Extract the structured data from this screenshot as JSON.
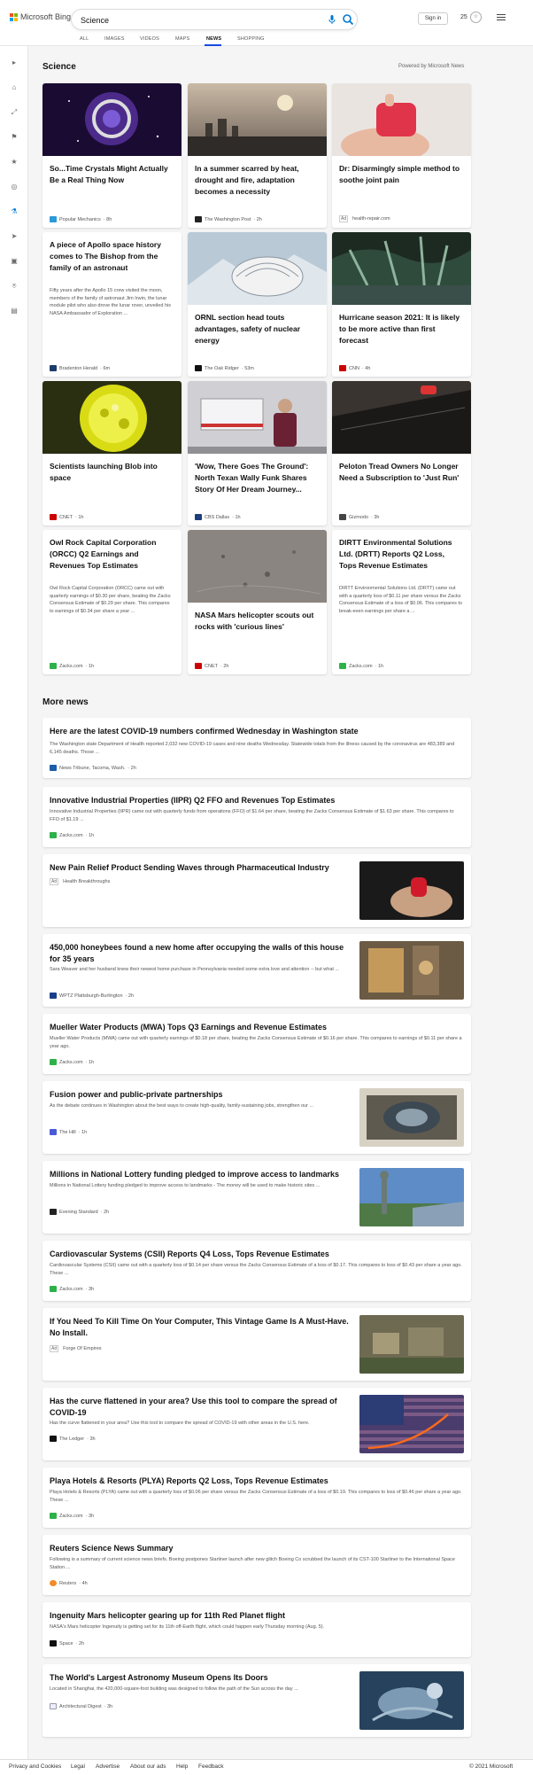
{
  "header": {
    "logo_text": "Microsoft Bing",
    "search_value": "Science",
    "sign_in": "Sign in",
    "rewards_count": "25"
  },
  "nav": {
    "tabs": [
      "ALL",
      "IMAGES",
      "VIDEOS",
      "MAPS",
      "NEWS",
      "SHOPPING"
    ],
    "active": "NEWS"
  },
  "section": {
    "title": "Science",
    "powered_by": "Powered by Microsoft News"
  },
  "cards": [
    {
      "title": "So...Time Crystals Might Actually Be a Real Thing Now",
      "snippet": "",
      "source": "Popular Mechanics",
      "time": "· 8h",
      "ad": false
    },
    {
      "title": "In a summer scarred by heat, drought and fire, adaptation becomes a necessity",
      "snippet": "",
      "source": "The Washington Post",
      "time": "· 2h",
      "ad": false
    },
    {
      "title": "Dr: Disarmingly simple method to soothe joint pain",
      "snippet": "",
      "source": "health-repair.com",
      "time": "",
      "ad": true
    },
    {
      "title": "A piece of Apollo space history comes to The Bishop from the family of an astronaut",
      "snippet": "Fifty years after the Apollo 15 crew visited the moon, members of the family of astronaut Jim Irwin, the lunar module pilot who also drove the lunar rover, unveiled his NASA Ambassador of Exploration ...",
      "source": "Bradenton Herald",
      "time": "· 6m",
      "ad": false
    },
    {
      "title": "ORNL section head touts advantages, safety of nuclear energy",
      "snippet": "",
      "source": "The Oak Ridger",
      "time": "· 53m",
      "ad": false
    },
    {
      "title": "Hurricane season 2021: It is likely to be more active than first forecast",
      "snippet": "",
      "source": "CNN",
      "time": "· 4h",
      "ad": false
    },
    {
      "title": "Scientists launching Blob into space",
      "snippet": "",
      "source": "CNET",
      "time": "· 1h",
      "ad": false
    },
    {
      "title": "'Wow, There Goes The Ground': North Texan Wally Funk Shares Story Of Her Dream Journey...",
      "snippet": "",
      "source": "CBS Dallas",
      "time": "· 1h",
      "ad": false
    },
    {
      "title": "Peloton Tread Owners No Longer Need a Subscription to 'Just Run'",
      "snippet": "",
      "source": "Gizmodo",
      "time": "· 3h",
      "ad": false
    },
    {
      "title": "Owl Rock Capital Corporation (ORCC) Q2 Earnings and Revenues Top Estimates",
      "snippet": "Owl Rock Capital Corporation (ORCC) came out with quarterly earnings of $0.30 per share, beating the Zacks Consensus Estimate of $0.29 per share. This compares to earnings of $0.34 per share a year ...",
      "source": "Zacks.com",
      "time": "· 1h",
      "ad": false
    },
    {
      "title": "NASA Mars helicopter scouts out rocks with 'curious lines'",
      "snippet": "",
      "source": "CNET",
      "time": "· 2h",
      "ad": false
    },
    {
      "title": "DIRTT Environmental Solutions Ltd. (DRTT) Reports Q2 Loss, Tops Revenue Estimates",
      "snippet": "DIRTT Environmental Solutions Ltd. (DRTT) came out with a quarterly loss of $0.11 per share versus the Zacks Consensus Estimate of a loss of $0.06. This compares to break-even earnings per share a ...",
      "source": "Zacks.com",
      "time": "· 1h",
      "ad": false
    }
  ],
  "more_news": {
    "title": "More news",
    "items": [
      {
        "title": "Here are the latest COVID-19 numbers confirmed Wednesday in Washington state",
        "snippet": "The Washington state Department of Health reported 2,032 new COVID-19 cases and nine deaths Wednesday. Statewide totals from the illness caused by the coronavirus are 483,389 and 6,145 deaths. Those ...",
        "source": "News Tribune, Tacoma, Wash.",
        "time": "· 2h",
        "ad": false
      },
      {
        "title": "Innovative Industrial Properties (IIPR) Q2 FFO and Revenues Top Estimates",
        "snippet": "Innovative Industrial Properties (IIPR) came out with quarterly funds from operations (FFO) of $1.64 per share, beating the Zacks Consensus Estimate of $1.63 per share. This compares to FFO of $1.19 ...",
        "source": "Zacks.com",
        "time": "· 1h",
        "ad": false
      },
      {
        "title": "New Pain Relief Product Sending Waves through Pharmaceutical Industry",
        "snippet": "",
        "source": "Health Breakthroughs",
        "time": "",
        "ad": true
      },
      {
        "title": "450,000 honeybees found a new home after occupying the walls of this house for 35 years",
        "snippet": "Sara Weaver and her husband knew their newest home purchase in Pennsylvania needed some extra love and attention -- but what ...",
        "source": "WPTZ Plattsburgh-Burlington",
        "time": "· 2h",
        "ad": false
      },
      {
        "title": "Mueller Water Products (MWA) Tops Q3 Earnings and Revenue Estimates",
        "snippet": "Mueller Water Products (MWA) came out with quarterly earnings of $0.18 per share, beating the Zacks Consensus Estimate of $0.16 per share. This compares to earnings of $0.11 per share a year ago.",
        "source": "Zacks.com",
        "time": "· 1h",
        "ad": false
      },
      {
        "title": "Fusion power and public-private partnerships",
        "snippet": "As the debate continues in Washington about the best ways to create high-quality, family-sustaining jobs, strengthen our ...",
        "source": "The Hill",
        "time": "· 1h",
        "ad": false
      },
      {
        "title": "Millions in National Lottery funding pledged to improve access to landmarks",
        "snippet": "Millions in National Lottery funding pledged to improve access to landmarks - The money will be used to make historic sites ...",
        "source": "Evening Standard",
        "time": "· 2h",
        "ad": false
      },
      {
        "title": "Cardiovascular Systems (CSII) Reports Q4 Loss, Tops Revenue Estimates",
        "snippet": "Cardiovascular Systems (CSII) came out with a quarterly loss of $0.14 per share versus the Zacks Consensus Estimate of a loss of $0.17. This compares to loss of $0.43 per share a year ago. These ...",
        "source": "Zacks.com",
        "time": "· 3h",
        "ad": false
      },
      {
        "title": "If You Need To Kill Time On Your Computer, This Vintage Game Is A Must-Have. No Install.",
        "snippet": "",
        "source": "Forge Of Empires",
        "time": "",
        "ad": true
      },
      {
        "title": "Has the curve flattened in your area? Use this tool to compare the spread of COVID-19",
        "snippet": "Has the curve flattened in your area? Use this tool to compare the spread of COVID-19 with other areas in the U.S. here.",
        "source": "The Ledger",
        "time": "· 3h",
        "ad": false
      },
      {
        "title": "Playa Hotels & Resorts (PLYA) Reports Q2 Loss, Tops Revenue Estimates",
        "snippet": "Playa Hotels & Resorts (PLYA) came out with a quarterly loss of $0.06 per share versus the Zacks Consensus Estimate of a loss of $0.19. This compares to loss of $0.46 per share a year ago. These ...",
        "source": "Zacks.com",
        "time": "· 3h",
        "ad": false
      },
      {
        "title": "Reuters Science News Summary",
        "snippet": "Following is a summary of current science news briefs. Boeing postpones Starliner launch after new glitch Boeing Co scrubbed the launch of its CST-100 Starliner to the International Space Station ...",
        "source": "Reuters",
        "time": "· 4h",
        "ad": false
      },
      {
        "title": "Ingenuity Mars helicopter gearing up for 11th Red Planet flight",
        "snippet": "NASA's Mars helicopter Ingenuity is getting set for its 11th off-Earth flight, which could happen early Thursday morning (Aug. 5).",
        "source": "Space",
        "time": "· 2h",
        "ad": false
      },
      {
        "title": "The World's Largest Astronomy Museum Opens Its Doors",
        "snippet": "Located in Shanghai, the 420,000-square-foot building was designed to follow the path of the Sun across the day ...",
        "source": "Architectural Digest",
        "time": "· 3h",
        "ad": false
      }
    ]
  },
  "footer": {
    "links": [
      "Privacy and Cookies",
      "Legal",
      "Advertise",
      "About our ads",
      "Help",
      "Feedback"
    ],
    "copyright": "© 2021 Microsoft"
  },
  "ad_label": "Ad",
  "colors": {
    "accent": "#0078d4",
    "nav_underline": "#174ae4",
    "zacks_green": "#2db24a",
    "cnn_red": "#cc0000"
  }
}
